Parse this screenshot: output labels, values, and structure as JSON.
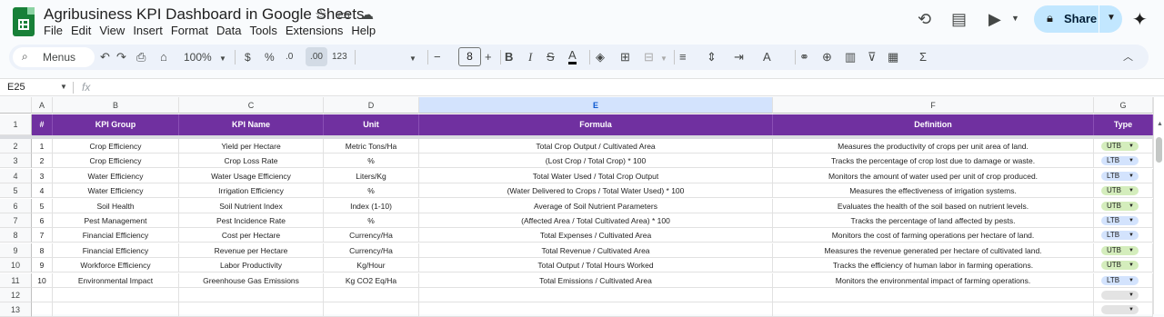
{
  "header": {
    "title": "Agribusiness KPI Dashboard in Google Sheets",
    "menu": [
      "File",
      "Edit",
      "View",
      "Insert",
      "Format",
      "Data",
      "Tools",
      "Extensions",
      "Help"
    ],
    "share_label": "Share"
  },
  "toolbar": {
    "search_label": "Menus",
    "zoom": "100%",
    "currency": "$",
    "percent": "%",
    "dec_decrease": ".0",
    "dec_increase": ".00",
    "number_format": "123",
    "font_size": "8"
  },
  "formula_bar": {
    "cell_ref": "E25",
    "fx": "fx",
    "content": ""
  },
  "grid": {
    "columns": [
      "A",
      "B",
      "C",
      "D",
      "E",
      "F",
      "G"
    ],
    "selected_column": "E",
    "header_row": [
      "#",
      "KPI Group",
      "KPI Name",
      "Unit",
      "Formula",
      "Definition",
      "Type"
    ],
    "row_numbers": [
      "1",
      "2",
      "3",
      "4",
      "5",
      "6",
      "7",
      "8",
      "9",
      "10",
      "11",
      "12",
      "13"
    ],
    "rows": [
      {
        "n": "1",
        "group": "Crop Efficiency",
        "name": "Yield per Hectare",
        "unit": "Metric Tons/Ha",
        "formula": "Total Crop Output / Cultivated Area",
        "definition": "Measures the productivity of crops per unit area of land.",
        "type": "UTB"
      },
      {
        "n": "2",
        "group": "Crop Efficiency",
        "name": "Crop Loss Rate",
        "unit": "%",
        "formula": "(Lost Crop / Total Crop) * 100",
        "definition": "Tracks the percentage of crop lost due to damage or waste.",
        "type": "LTB"
      },
      {
        "n": "3",
        "group": "Water Efficiency",
        "name": "Water Usage Efficiency",
        "unit": "Liters/Kg",
        "formula": "Total Water Used / Total Crop Output",
        "definition": "Monitors the amount of water used per unit of crop produced.",
        "type": "LTB"
      },
      {
        "n": "4",
        "group": "Water Efficiency",
        "name": "Irrigation Efficiency",
        "unit": "%",
        "formula": "(Water Delivered to Crops / Total Water Used) * 100",
        "definition": "Measures the effectiveness of irrigation systems.",
        "type": "UTB"
      },
      {
        "n": "5",
        "group": "Soil Health",
        "name": "Soil Nutrient Index",
        "unit": "Index (1-10)",
        "formula": "Average of Soil Nutrient Parameters",
        "definition": "Evaluates the health of the soil based on nutrient levels.",
        "type": "UTB"
      },
      {
        "n": "6",
        "group": "Pest Management",
        "name": "Pest Incidence Rate",
        "unit": "%",
        "formula": "(Affected Area / Total Cultivated Area) * 100",
        "definition": "Tracks the percentage of land affected by pests.",
        "type": "LTB"
      },
      {
        "n": "7",
        "group": "Financial Efficiency",
        "name": "Cost per Hectare",
        "unit": "Currency/Ha",
        "formula": "Total Expenses / Cultivated Area",
        "definition": "Monitors the cost of farming operations per hectare of land.",
        "type": "LTB"
      },
      {
        "n": "8",
        "group": "Financial Efficiency",
        "name": "Revenue per Hectare",
        "unit": "Currency/Ha",
        "formula": "Total Revenue / Cultivated Area",
        "definition": "Measures the revenue generated per hectare of cultivated land.",
        "type": "UTB"
      },
      {
        "n": "9",
        "group": "Workforce Efficiency",
        "name": "Labor Productivity",
        "unit": "Kg/Hour",
        "formula": "Total Output / Total Hours Worked",
        "definition": "Tracks the efficiency of human labor in farming operations.",
        "type": "UTB"
      },
      {
        "n": "10",
        "group": "Environmental Impact",
        "name": "Greenhouse Gas Emissions",
        "unit": "Kg CO2 Eq/Ha",
        "formula": "Total Emissions / Cultivated Area",
        "definition": "Monitors the environmental impact of farming operations.",
        "type": "LTB"
      }
    ]
  },
  "colors": {
    "header_fill": "#7030a0",
    "utb_chip": "#d4edbc",
    "ltb_chip": "#d3e3fd",
    "share_fill": "#c2e7ff",
    "logo": "#188038"
  }
}
